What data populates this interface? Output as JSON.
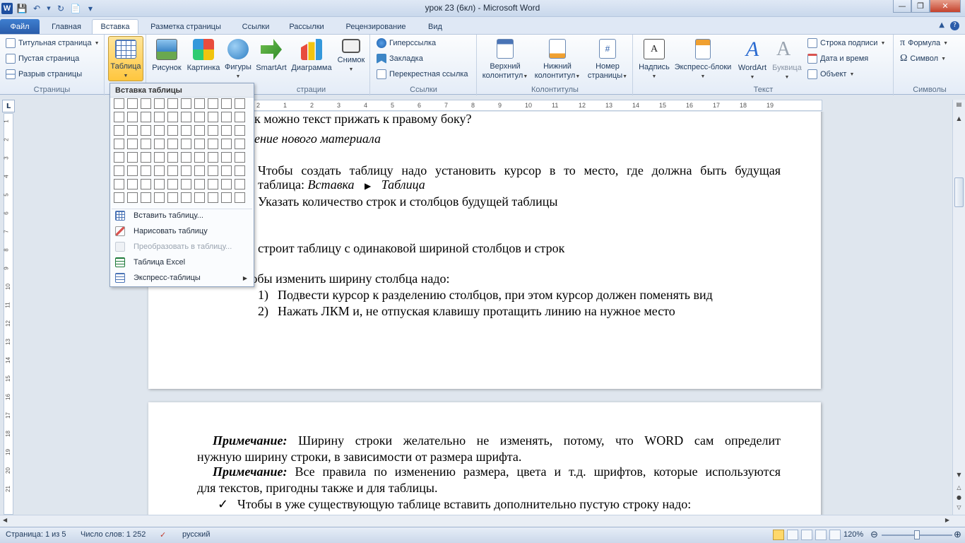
{
  "window": {
    "title": "урок 23 (6кл)  -  Microsoft Word"
  },
  "tabs": [
    "Файл",
    "Главная",
    "Вставка",
    "Разметка страницы",
    "Ссылки",
    "Рассылки",
    "Рецензирование",
    "Вид"
  ],
  "active_tab": "Вставка",
  "ribbon": {
    "pages": {
      "title_page": "Титульная страница",
      "blank_page": "Пустая страница",
      "page_break": "Разрыв страницы",
      "label": "Страницы"
    },
    "tables": {
      "table": "Таблица"
    },
    "illustrations": {
      "picture": "Рисунок",
      "clipart": "Картинка",
      "shapes": "Фигуры",
      "smartart": "SmartArt",
      "chart": "Диаграмма",
      "screenshot": "Снимок",
      "label": "страции"
    },
    "links": {
      "hyperlink": "Гиперссылка",
      "bookmark": "Закладка",
      "crossref": "Перекрестная ссылка",
      "label": "Ссылки"
    },
    "header_footer": {
      "header_1": "Верхний",
      "header_2": "колонтитул",
      "footer_1": "Нижний",
      "footer_2": "колонтитул",
      "pagenum_1": "Номер",
      "pagenum_2": "страницы",
      "label": "Колонтитулы"
    },
    "text": {
      "textbox": "Надпись",
      "quickparts": "Экспресс-блоки",
      "wordart": "WordArt",
      "dropcap": "Буквица",
      "signature": "Строка подписи",
      "datetime": "Дата и время",
      "object": "Объект",
      "label": "Текст"
    },
    "symbols": {
      "equation": "Формула",
      "symbol": "Символ",
      "label": "Символы"
    }
  },
  "ruler": {
    "h_numbers": [
      "2",
      "1",
      "2",
      "3",
      "4",
      "5",
      "6",
      "7",
      "8",
      "9",
      "10",
      "11",
      "12",
      "13",
      "14",
      "15",
      "16",
      "17",
      "18",
      "19"
    ],
    "v_numbers": [
      "1",
      "2",
      "3",
      "4",
      "5",
      "6",
      "7",
      "8",
      "9",
      "10",
      "11",
      "12",
      "13",
      "14",
      "15",
      "16",
      "17",
      "18",
      "19",
      "20",
      "21"
    ],
    "box": "L"
  },
  "table_menu": {
    "header": "Вставка таблицы",
    "grid_cols": 10,
    "grid_rows": 8,
    "items": [
      {
        "label": "Вставить таблицу...",
        "icon": "insert-table-icon",
        "disabled": false
      },
      {
        "label": "Нарисовать таблицу",
        "icon": "pencil-icon",
        "disabled": false
      },
      {
        "label": "Преобразовать в таблицу...",
        "icon": "convert-icon",
        "disabled": true
      },
      {
        "label": "Таблица Excel",
        "icon": "excel-icon",
        "disabled": false
      },
      {
        "label": "Экспресс-таблицы",
        "icon": "quick-tables-icon",
        "disabled": false
      }
    ]
  },
  "page1": {
    "l1": "к можно текст прижать к правому боку?",
    "l2": "ение нового материала",
    "l3": "Чтобы создать таблицу надо установить курсор в то место, где должна быть будущая",
    "l4a": "таблица: ",
    "l4b": "Вставка",
    "l4c": "Таблица",
    "l5": "Указать количество строк и столбцов будущей таблицы",
    "l6": "строит таблицу с одинаковой шириной столбцов и строк",
    "l7": "Чтобы изменить ширину столбца надо:",
    "l8n": "1)",
    "l8": "Подвести курсор к разделению столбцов, при этом курсор должен поменять вид",
    "l9n": "2)",
    "l9": "Нажать ЛКМ и, не отпуская клавишу протащить линию на нужное место"
  },
  "page2": {
    "n1_label": "Примечание:",
    "n1_text": " Ширину строки желательно не изменять, потому, что WORD сам определит",
    "n1_text2": "нужную ширину строки, в зависимости от размера шрифта.",
    "n2_label": "Примечание:",
    "n2_text": " Все правила по изменению размера, цвета и т.д. шрифтов, которые используются",
    "n2_text2": "для текстов, пригодны также и для таблицы.",
    "bullet": "Чтобы в уже существующую таблице вставить дополнительно пустую строку надо:"
  },
  "status": {
    "page": "Страница: 1 из 5",
    "words": "Число слов: 1 252",
    "lang": "русский",
    "zoom": "120%"
  },
  "colors": {
    "accent": "#2a5caa",
    "pressed": "#ffc63e"
  }
}
